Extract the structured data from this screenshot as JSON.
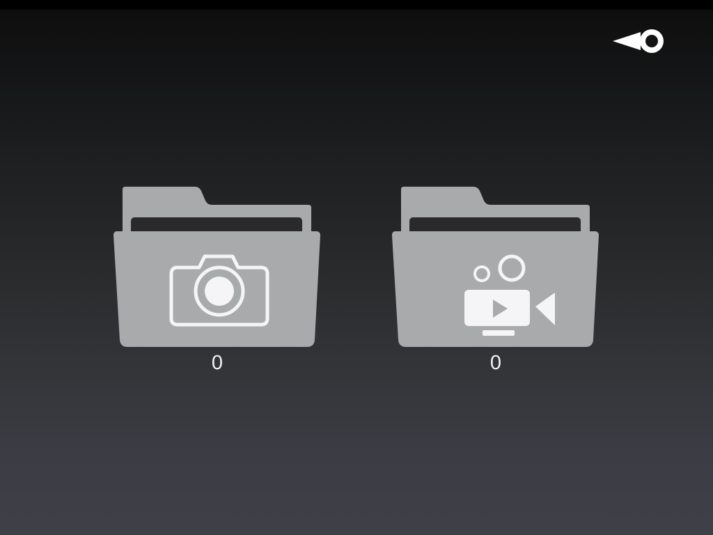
{
  "status_bar": {
    "visible_text": ""
  },
  "toolbar": {
    "back_icon": "back-pointer-icon"
  },
  "folders": [
    {
      "id": "photos",
      "icon": "camera-icon",
      "count": "0"
    },
    {
      "id": "videos",
      "icon": "video-camera-icon",
      "count": "0"
    }
  ],
  "colors": {
    "folder": "#a9aaac",
    "folder_inner": "#2a2a2c",
    "icon": "#f5f5f7",
    "text": "#f2f2f4"
  }
}
